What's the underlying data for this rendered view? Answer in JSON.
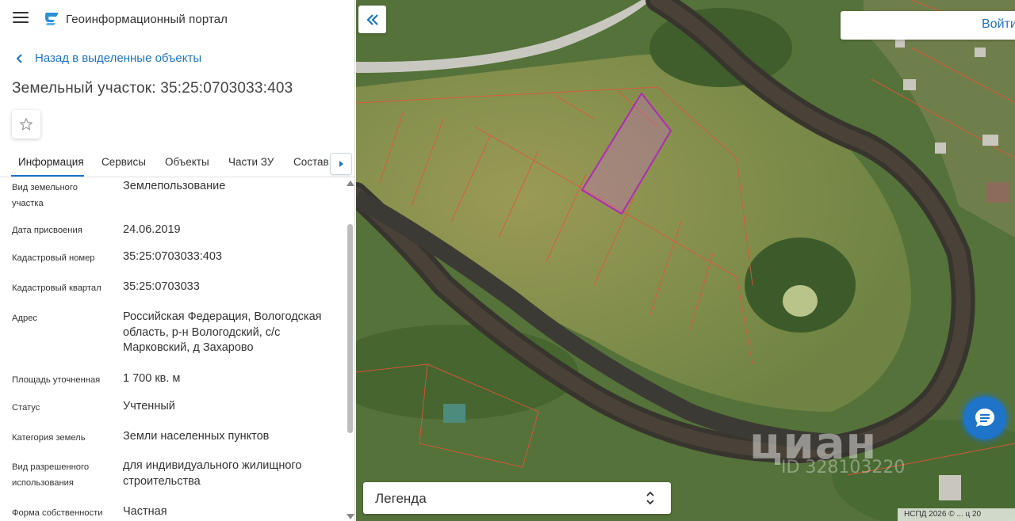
{
  "header": {
    "portal_title": "Геоинформационный портал",
    "menu_icon": "hamburger-icon",
    "logo_icon": "portal-logo"
  },
  "navigation": {
    "back_label": "Назад в выделенные объекты"
  },
  "parcel": {
    "title": "Земельный участок: 35:25:0703033:403"
  },
  "tabs": [
    {
      "label": "Информация",
      "active": true
    },
    {
      "label": "Сервисы",
      "active": false
    },
    {
      "label": "Объекты",
      "active": false
    },
    {
      "label": "Части ЗУ",
      "active": false
    },
    {
      "label": "Состав",
      "active": false
    }
  ],
  "info_rows": [
    {
      "label": "Вид земельного участка",
      "value": "Землепользование"
    },
    {
      "label": "Дата присвоения",
      "value": "24.06.2019"
    },
    {
      "label": "Кадастровый номер",
      "value": "35:25:0703033:403"
    },
    {
      "label": "Кадастровый квартал",
      "value": "35:25:0703033"
    },
    {
      "label": "Адрес",
      "value": "Российская Федерация, Вологодская область, р-н Вологодский, с/с Марковский, д Захарово"
    },
    {
      "label": "Площадь уточненная",
      "value": "1 700 кв. м"
    },
    {
      "label": "Статус",
      "value": "Учтенный"
    },
    {
      "label": "Категория земель",
      "value": "Земли населенных пунктов"
    },
    {
      "label": "Вид разрешенного использования",
      "value": "для индивидуального жилищного строительства"
    },
    {
      "label": "Форма собственности",
      "value": "Частная"
    }
  ],
  "map": {
    "login_label": "Войти",
    "legend_label": "Легенда",
    "watermark": "циан",
    "watermark_id": "ID 328103220",
    "attribution": "НСПД 2026 © ... ц 20",
    "highlight_color": "#b02ab4",
    "parcel_line_color": "#e0553a",
    "accent_color": "#1d74c8"
  }
}
